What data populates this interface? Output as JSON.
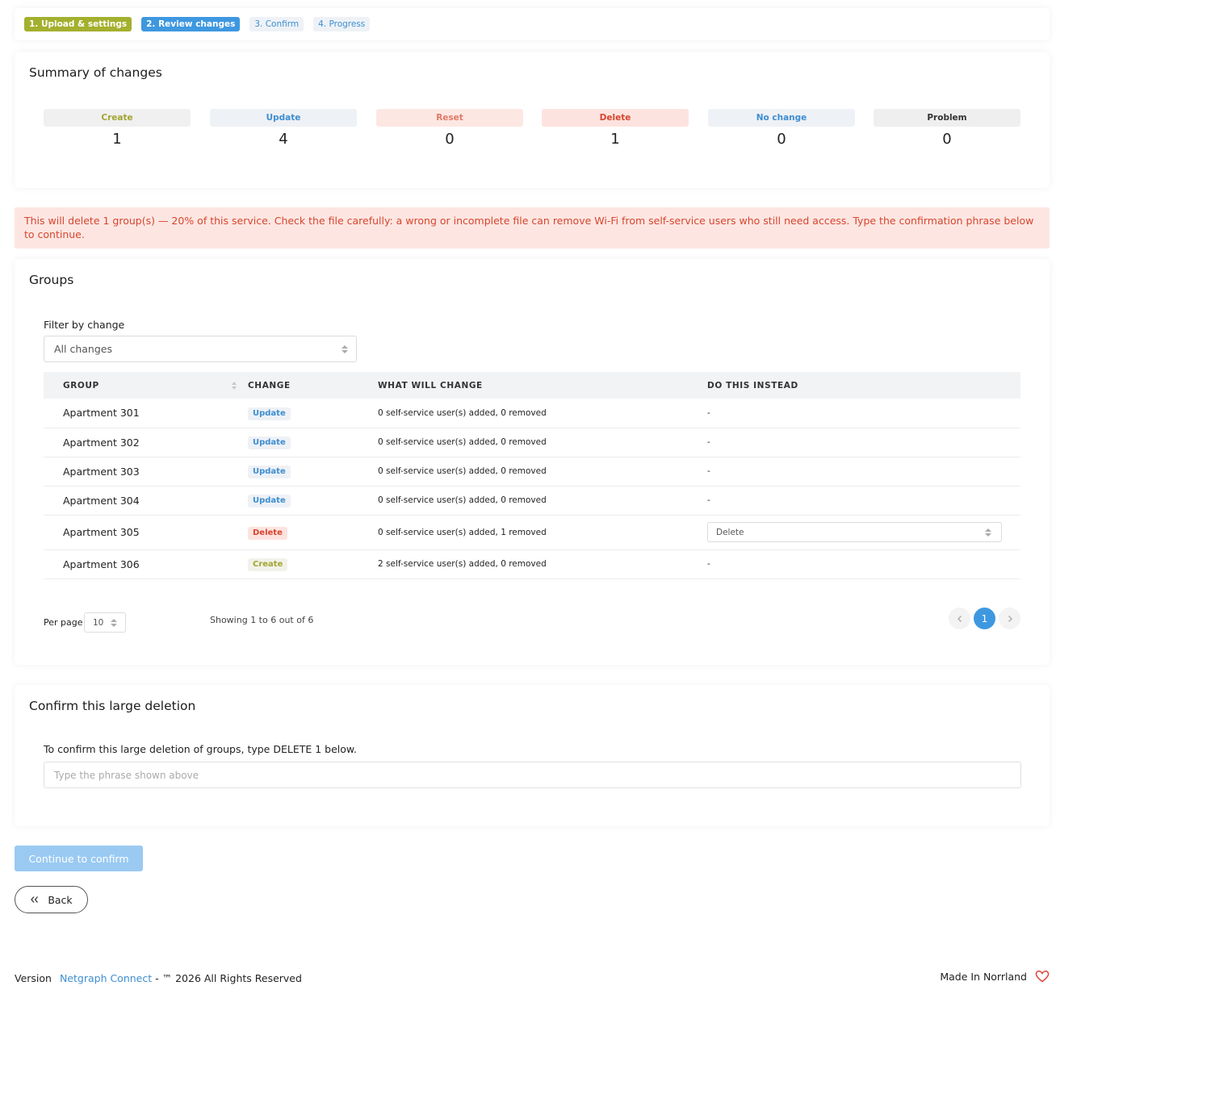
{
  "stepper": [
    {
      "label": "1. Upload & settings",
      "state": "done"
    },
    {
      "label": "2. Review changes",
      "state": "active"
    },
    {
      "label": "3. Confirm",
      "state": "todo"
    },
    {
      "label": "4. Progress",
      "state": "todo"
    }
  ],
  "summary": {
    "title": "Summary of changes",
    "stats": [
      {
        "label": "Create",
        "value": "1"
      },
      {
        "label": "Update",
        "value": "4"
      },
      {
        "label": "Reset",
        "value": "0"
      },
      {
        "label": "Delete",
        "value": "1"
      },
      {
        "label": "No change",
        "value": "0"
      },
      {
        "label": "Problem",
        "value": "0"
      }
    ]
  },
  "warning": "This will delete 1 group(s) — 20% of this service. Check the file carefully: a wrong or incomplete file can remove Wi-Fi from self-service users who still need access. Type the confirmation phrase below to continue.",
  "groups": {
    "title": "Groups",
    "filter_label": "Filter by change",
    "filter_value": "All changes",
    "columns": [
      "GROUP",
      "CHANGE",
      "WHAT WILL CHANGE",
      "DO THIS INSTEAD"
    ],
    "rows": [
      {
        "group": "Apartment 301",
        "change": "Update",
        "what": "0 self-service user(s) added, 0 removed",
        "instead": "-"
      },
      {
        "group": "Apartment 302",
        "change": "Update",
        "what": "0 self-service user(s) added, 0 removed",
        "instead": "-"
      },
      {
        "group": "Apartment 303",
        "change": "Update",
        "what": "0 self-service user(s) added, 0 removed",
        "instead": "-"
      },
      {
        "group": "Apartment 304",
        "change": "Update",
        "what": "0 self-service user(s) added, 0 removed",
        "instead": "-"
      },
      {
        "group": "Apartment 305",
        "change": "Delete",
        "what": "0 self-service user(s) added, 1 removed",
        "instead": "Delete"
      },
      {
        "group": "Apartment 306",
        "change": "Create",
        "what": "2 self-service user(s) added, 0 removed",
        "instead": "-"
      }
    ],
    "per_page_label": "Per page",
    "per_page_value": "10",
    "showing": "Showing 1 to 6 out of 6",
    "current_page": "1"
  },
  "confirm": {
    "title": "Confirm this large deletion",
    "instruction": "To confirm this large deletion of groups, type DELETE 1 below.",
    "placeholder": "Type the phrase shown above",
    "value": ""
  },
  "actions": {
    "continue_label": "Continue to confirm",
    "back_label": "Back"
  },
  "footer": {
    "version_label": "Version",
    "brand_link": "Netgraph Connect",
    "rights": "- ™ 2026 All Rights Reserved",
    "made_in": "Made In Norrland"
  },
  "icons": {
    "back": "double-chevron-left-icon",
    "heart": "heart-icon",
    "prev": "chevron-left-icon",
    "next": "chevron-right-icon"
  }
}
